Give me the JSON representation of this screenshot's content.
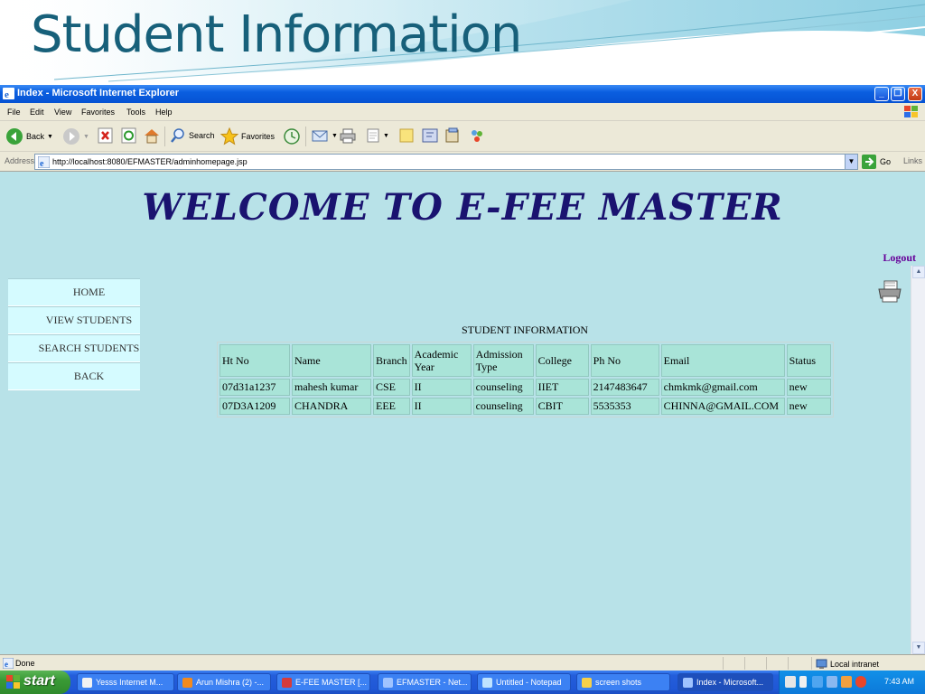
{
  "slide": {
    "title": "Student Information"
  },
  "window": {
    "title": "Index - Microsoft Internet Explorer",
    "minimize": "_",
    "maximize": "❐",
    "close": "X"
  },
  "menu": [
    "File",
    "Edit",
    "View",
    "Favorites",
    "Tools",
    "Help"
  ],
  "toolbar": {
    "back": "Back",
    "search": "Search",
    "favorites": "Favorites"
  },
  "address": {
    "label": "Address",
    "url": "http://localhost:8080/EFMASTER/adminhomepage.jsp",
    "go": "Go",
    "links": "Links"
  },
  "page": {
    "welcome": "WELCOME TO E-FEE MASTER",
    "logout": "Logout",
    "nav": [
      "HOME",
      "VIEW STUDENTS",
      "SEARCH STUDENTS",
      "BACK"
    ],
    "table_caption": "STUDENT INFORMATION",
    "table": {
      "columns": [
        "Ht No",
        "Name",
        "Branch",
        "Academic Year",
        "Admission Type",
        "College",
        "Ph No",
        "Email",
        "Status"
      ],
      "rows": [
        [
          "07d31a1237",
          "mahesh kumar",
          "CSE",
          "II",
          "counseling",
          "IIET",
          "2147483647",
          "chmkmk@gmail.com",
          "new"
        ],
        [
          "07D3A1209",
          "CHANDRA",
          "EEE",
          "II",
          "counseling",
          "CBIT",
          "5535353",
          "CHINNA@GMAIL.COM",
          "new"
        ]
      ]
    }
  },
  "status": {
    "text": "Done",
    "zone": "Local intranet"
  },
  "taskbar": {
    "start": "start",
    "tasks": [
      {
        "label": "Yesss Internet M...",
        "color": "#f2f2f2"
      },
      {
        "label": "Arun Mishra (2) -...",
        "color": "#f28a1e"
      },
      {
        "label": "E-FEE MASTER [...",
        "color": "#d63b3b"
      },
      {
        "label": "EFMASTER - Net...",
        "color": "#9fc3ff"
      },
      {
        "label": "Untitled - Notepad",
        "color": "#bfe3ff"
      },
      {
        "label": "screen shots",
        "color": "#f7d04a"
      },
      {
        "label": "Index - Microsoft...",
        "color": "#9fc3ff"
      }
    ],
    "clock": "7:43 AM"
  }
}
